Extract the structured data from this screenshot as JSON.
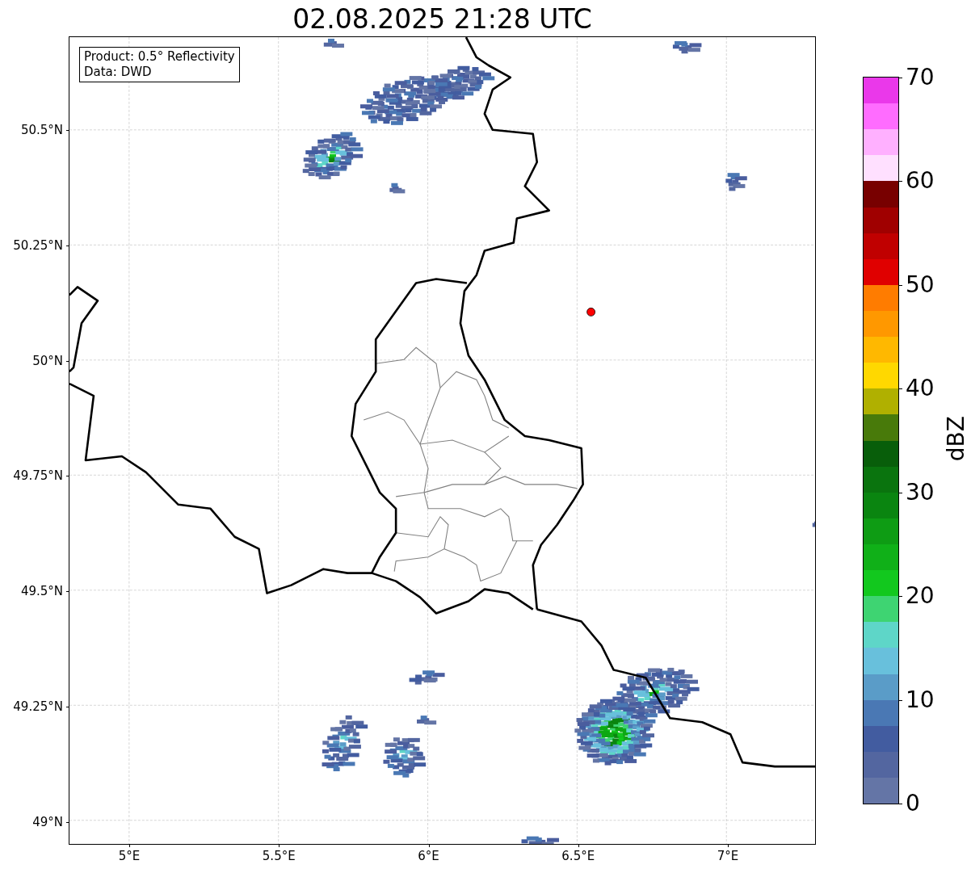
{
  "title": "02.08.2025 21:28 UTC",
  "info_box": [
    "Product: 0.5° Reflectivity",
    "Data: DWD"
  ],
  "x_ticks": [
    "5°E",
    "5.5°E",
    "6°E",
    "6.5°E",
    "7°E"
  ],
  "y_ticks": [
    "50.5°N",
    "50.25°N",
    "50°N",
    "49.75°N",
    "49.5°N",
    "49.25°N",
    "49°N"
  ],
  "colorbar": {
    "label": "dBZ",
    "ticks": [
      "70",
      "60",
      "50",
      "40",
      "30",
      "20",
      "10",
      "0"
    ],
    "bins": [
      {
        "color": "#ea38ea"
      },
      {
        "color": "#ff6cff"
      },
      {
        "color": "#ffb0ff"
      },
      {
        "color": "#ffe0ff"
      },
      {
        "color": "#780000"
      },
      {
        "color": "#a00000"
      },
      {
        "color": "#c00000"
      },
      {
        "color": "#e00000"
      },
      {
        "color": "#ff7c00"
      },
      {
        "color": "#ff9800"
      },
      {
        "color": "#ffb800"
      },
      {
        "color": "#ffd800"
      },
      {
        "color": "#b0b000"
      },
      {
        "color": "#487a0a"
      },
      {
        "color": "#085e0a"
      },
      {
        "color": "#0a740e"
      },
      {
        "color": "#0a8510"
      },
      {
        "color": "#0e9c14"
      },
      {
        "color": "#10b018"
      },
      {
        "color": "#12c81e"
      },
      {
        "color": "#3ed472"
      },
      {
        "color": "#5ed6c8"
      },
      {
        "color": "#68c0dc"
      },
      {
        "color": "#5a9cc8"
      },
      {
        "color": "#4a78b4"
      },
      {
        "color": "#425ca0"
      },
      {
        "color": "#5366a0"
      },
      {
        "color": "#6475a6"
      }
    ]
  }
}
